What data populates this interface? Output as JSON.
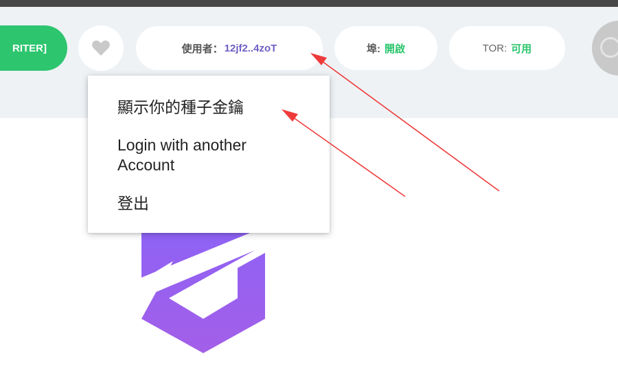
{
  "header": {
    "role_badge": "RITER]",
    "user": {
      "label": "使用者：",
      "value": "12jf2..4zoT"
    },
    "port": {
      "label": "埠:",
      "value": "開啟"
    },
    "tor": {
      "label": "TOR:",
      "value": "可用"
    }
  },
  "dropdown": {
    "items": [
      {
        "label": "顯示你的種子金鑰"
      },
      {
        "label": "Login with another Account"
      },
      {
        "label": "登出"
      }
    ]
  },
  "colors": {
    "header_bg": "#eef2f5",
    "green": "#2dc56e",
    "user_purple": "#6f5fc4",
    "arrow_red": "#ee3a3a",
    "logo_purple": "#9a5cf0"
  },
  "icons": [
    "heart-icon",
    "avatar-icon",
    "app-logo"
  ]
}
